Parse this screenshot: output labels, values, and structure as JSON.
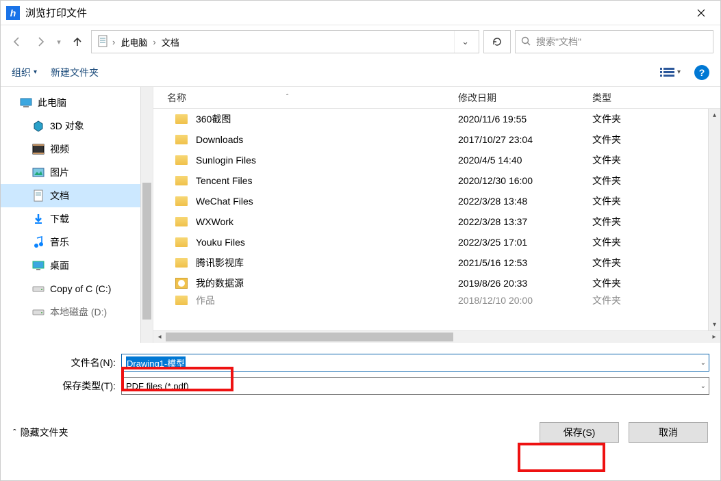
{
  "window": {
    "title": "浏览打印文件",
    "app_icon_text": "h"
  },
  "nav": {
    "breadcrumb": [
      "此电脑",
      "文档"
    ],
    "search_placeholder": "搜索\"文档\""
  },
  "toolbar": {
    "organize": "组织",
    "new_folder": "新建文件夹"
  },
  "sidebar": {
    "root": "此电脑",
    "items": [
      {
        "label": "3D 对象",
        "icon": "3d"
      },
      {
        "label": "视频",
        "icon": "video"
      },
      {
        "label": "图片",
        "icon": "pictures"
      },
      {
        "label": "文档",
        "icon": "documents",
        "selected": true
      },
      {
        "label": "下载",
        "icon": "downloads"
      },
      {
        "label": "音乐",
        "icon": "music"
      },
      {
        "label": "桌面",
        "icon": "desktop"
      },
      {
        "label": "Copy of C (C:)",
        "icon": "drive"
      },
      {
        "label": "本地磁盘 (D:)",
        "icon": "drive"
      }
    ]
  },
  "columns": {
    "name": "名称",
    "date": "修改日期",
    "type": "类型"
  },
  "files": [
    {
      "name": "360截图",
      "date": "2020/11/6 19:55",
      "type": "文件夹",
      "icon": "folder"
    },
    {
      "name": "Downloads",
      "date": "2017/10/27 23:04",
      "type": "文件夹",
      "icon": "folder"
    },
    {
      "name": "Sunlogin Files",
      "date": "2020/4/5 14:40",
      "type": "文件夹",
      "icon": "folder"
    },
    {
      "name": "Tencent Files",
      "date": "2020/12/30 16:00",
      "type": "文件夹",
      "icon": "folder"
    },
    {
      "name": "WeChat Files",
      "date": "2022/3/28 13:48",
      "type": "文件夹",
      "icon": "folder"
    },
    {
      "name": "WXWork",
      "date": "2022/3/28 13:37",
      "type": "文件夹",
      "icon": "folder"
    },
    {
      "name": "Youku Files",
      "date": "2022/3/25 17:01",
      "type": "文件夹",
      "icon": "folder"
    },
    {
      "name": "腾讯影视库",
      "date": "2021/5/16 12:53",
      "type": "文件夹",
      "icon": "folder"
    },
    {
      "name": "我的数据源",
      "date": "2019/8/26 20:33",
      "type": "文件夹",
      "icon": "special"
    },
    {
      "name": "作品",
      "date": "2018/12/10 20:00",
      "type": "文件夹",
      "icon": "folder"
    }
  ],
  "inputs": {
    "filename_label": "文件名(N):",
    "filename_value": "Drawing1-模型",
    "filetype_label": "保存类型(T):",
    "filetype_value": "PDF files (*.pdf)"
  },
  "footer": {
    "hide_folders": "隐藏文件夹",
    "save": "保存(S)",
    "cancel": "取消"
  }
}
